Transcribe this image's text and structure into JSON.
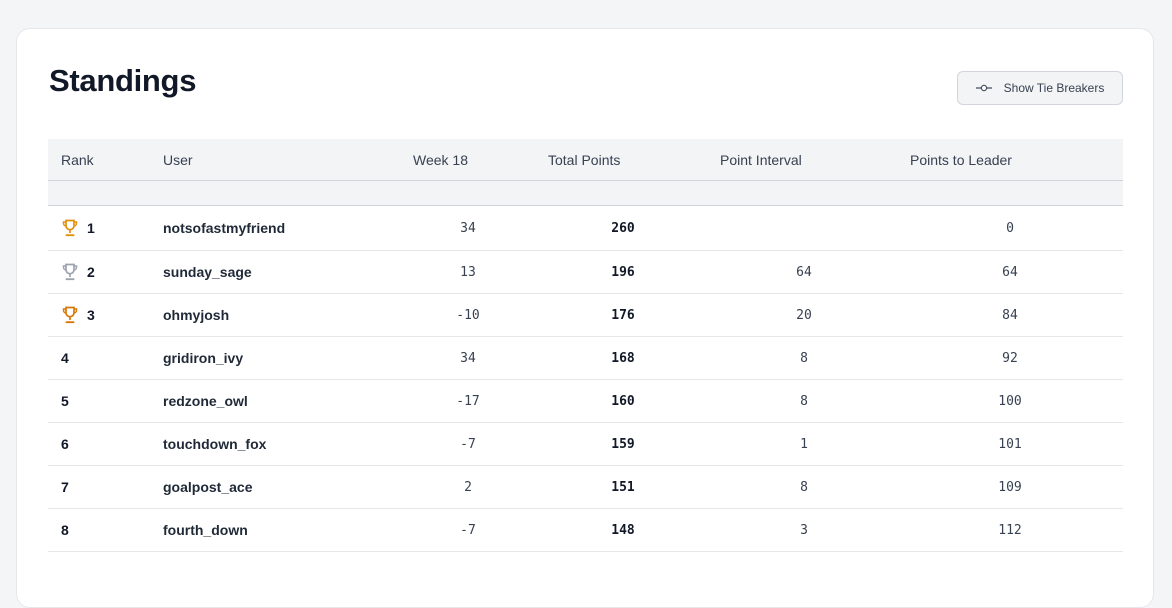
{
  "page": {
    "title": "Standings",
    "tie_breakers_label": "Show Tie Breakers"
  },
  "table": {
    "headers": {
      "rank": "Rank",
      "user": "User",
      "week": "Week 18",
      "total": "Total Points",
      "interval": "Point Interval",
      "leader": "Points to Leader"
    },
    "rows": [
      {
        "rank": "1",
        "trophy": "gold",
        "user": "notsofastmyfriend",
        "week": "34",
        "total": "260",
        "interval": "",
        "leader": "0"
      },
      {
        "rank": "2",
        "trophy": "silver",
        "user": "sunday_sage",
        "week": "13",
        "total": "196",
        "interval": "64",
        "leader": "64"
      },
      {
        "rank": "3",
        "trophy": "bronze",
        "user": "ohmyjosh",
        "week": "-10",
        "total": "176",
        "interval": "20",
        "leader": "84"
      },
      {
        "rank": "4",
        "trophy": "",
        "user": "gridiron_ivy",
        "week": "34",
        "total": "168",
        "interval": "8",
        "leader": "92"
      },
      {
        "rank": "5",
        "trophy": "",
        "user": "redzone_owl",
        "week": "-17",
        "total": "160",
        "interval": "8",
        "leader": "100"
      },
      {
        "rank": "6",
        "trophy": "",
        "user": "touchdown_fox",
        "week": "-7",
        "total": "159",
        "interval": "1",
        "leader": "101"
      },
      {
        "rank": "7",
        "trophy": "",
        "user": "goalpost_ace",
        "week": "2",
        "total": "151",
        "interval": "8",
        "leader": "109"
      },
      {
        "rank": "8",
        "trophy": "",
        "user": "fourth_down",
        "week": "-7",
        "total": "148",
        "interval": "3",
        "leader": "112"
      }
    ]
  },
  "colors": {
    "gold": "#e0900d",
    "silver": "#9ca3af",
    "bronze": "#d97706"
  },
  "icons": {
    "tie_breakers": "commit-icon",
    "trophy": "trophy-icon"
  }
}
